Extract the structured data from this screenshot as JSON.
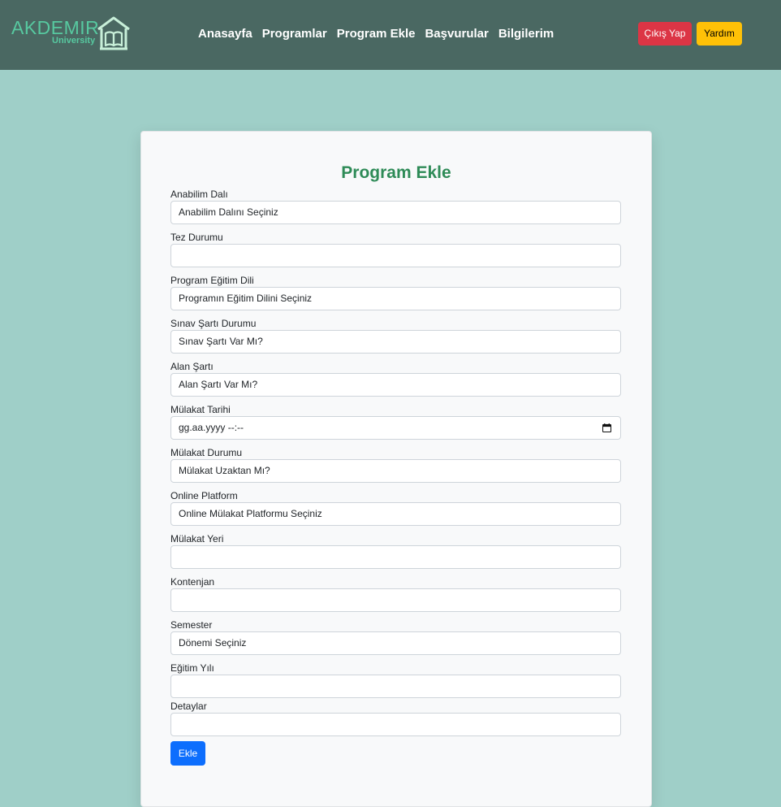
{
  "brand": {
    "name": "AKDEMIR",
    "subtitle": "University"
  },
  "nav": {
    "links": [
      "Anasayfa",
      "Programlar",
      "Program Ekle",
      "Başvurular",
      "Bilgilerim"
    ],
    "logout_label": "Çıkış Yap",
    "help_label": "Yardım"
  },
  "colors": {
    "navbar": "#4a6862",
    "page_background": "#9fcfc8",
    "brand": "#57c9a0",
    "title": "#2e8b57",
    "logout": "#dc3545",
    "help": "#ffc107",
    "submit": "#0d6efd"
  },
  "form": {
    "title": "Program Ekle",
    "fields": [
      {
        "label": "Anabilim Dalı",
        "type": "select",
        "value": "Anabilim Dalını Seçiniz"
      },
      {
        "label": "Tez Durumu",
        "type": "text",
        "value": ""
      },
      {
        "label": "Program Eğitim Dili",
        "type": "select",
        "value": "Programın Eğitim Dilini Seçiniz"
      },
      {
        "label": "Sınav Şartı Durumu",
        "type": "select",
        "value": "Sınav Şartı Var Mı?"
      },
      {
        "label": "Alan Şartı",
        "type": "select",
        "value": "Alan Şartı Var Mı?"
      },
      {
        "label": "Mülakat Tarihi",
        "type": "datetime",
        "value": "gg.aa.yyyy --:--",
        "icon": "calendar-icon"
      },
      {
        "label": "Mülakat Durumu",
        "type": "select",
        "value": "Mülakat Uzaktan Mı?"
      },
      {
        "label": "Online Platform",
        "type": "select",
        "value": "Online Mülakat Platformu Seçiniz"
      },
      {
        "label": "Mülakat Yeri",
        "type": "text",
        "value": ""
      },
      {
        "label": "Kontenjan",
        "type": "text",
        "value": ""
      },
      {
        "label": "Semester",
        "type": "select",
        "value": "Dönemi Seçiniz"
      },
      {
        "label": "Eğitim Yılı",
        "type": "text",
        "value": ""
      },
      {
        "label": "Detaylar",
        "type": "text",
        "value": ""
      }
    ],
    "submit_label": "Ekle"
  }
}
